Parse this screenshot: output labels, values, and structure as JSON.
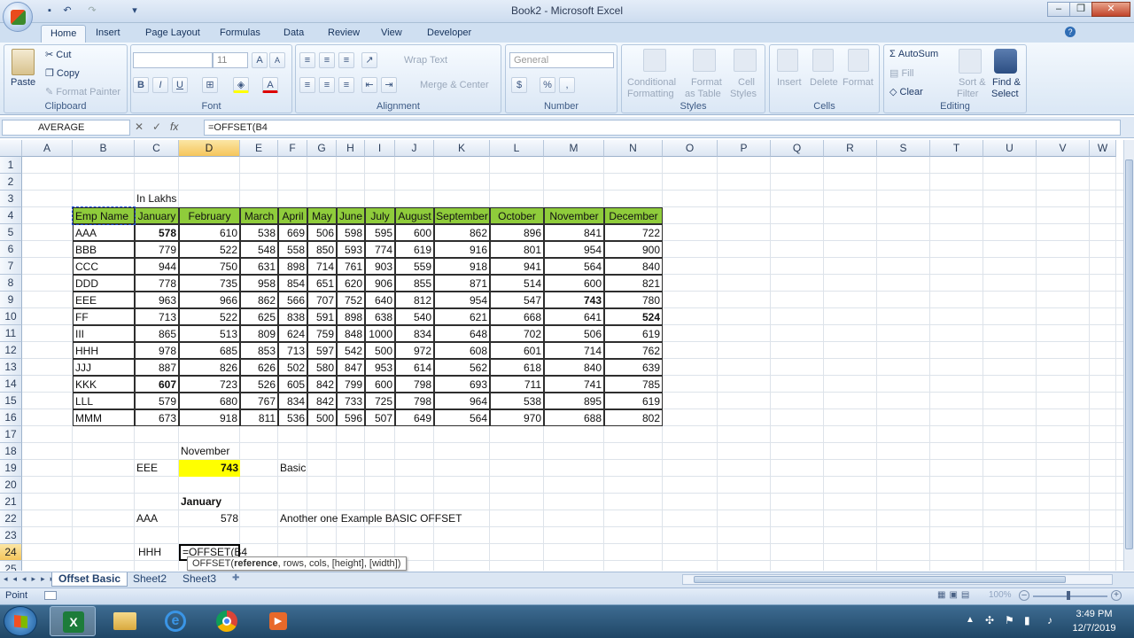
{
  "window": {
    "title": "Book2 - Microsoft Excel"
  },
  "tabs": [
    "Home",
    "Insert",
    "Page Layout",
    "Formulas",
    "Data",
    "Review",
    "View",
    "Developer"
  ],
  "active_tab": "Home",
  "ribbon": {
    "clipboard": {
      "paste": "Paste",
      "cut": "Cut",
      "copy": "Copy",
      "format_painter": "Format Painter",
      "label": "Clipboard"
    },
    "font": {
      "size": "11",
      "label": "Font"
    },
    "alignment": {
      "wrap_text": "Wrap Text",
      "merge_center": "Merge & Center",
      "label": "Alignment"
    },
    "number": {
      "format": "General",
      "label": "Number"
    },
    "styles": {
      "conditional": "Conditional",
      "formatting": "Formatting",
      "format": "Format",
      "as_table": "as Table",
      "cell": "Cell",
      "cell_styles": "Styles",
      "label": "Styles"
    },
    "cells": {
      "insert": "Insert",
      "delete": "Delete",
      "format": "Format",
      "label": "Cells"
    },
    "editing": {
      "autosum": "AutoSum",
      "fill": "Fill",
      "clear": "Clear",
      "sort": "Sort &",
      "filter": "Filter",
      "find": "Find &",
      "select": "Select",
      "label": "Editing"
    }
  },
  "namebox": "AVERAGE",
  "formula": "=OFFSET(B4",
  "columns": [
    "A",
    "B",
    "C",
    "D",
    "E",
    "F",
    "G",
    "H",
    "I",
    "J",
    "K",
    "L",
    "M",
    "N",
    "O",
    "P",
    "Q",
    "R",
    "S",
    "T",
    "U",
    "V",
    "W"
  ],
  "rows": [
    "1",
    "2",
    "3",
    "4",
    "5",
    "6",
    "7",
    "8",
    "9",
    "10",
    "11",
    "12",
    "13",
    "14",
    "15",
    "16",
    "17",
    "18",
    "19",
    "20",
    "21",
    "22",
    "23",
    "24",
    "25"
  ],
  "sheet": {
    "in_lakhs": "In Lakhs",
    "header": [
      "Emp Name",
      "January",
      "February",
      "March",
      "April",
      "May",
      "June",
      "July",
      "August",
      "September",
      "October",
      "November",
      "December"
    ],
    "data": [
      [
        "AAA",
        "578",
        "610",
        "538",
        "669",
        "506",
        "598",
        "595",
        "600",
        "862",
        "896",
        "841",
        "722"
      ],
      [
        "BBB",
        "779",
        "522",
        "548",
        "558",
        "850",
        "593",
        "774",
        "619",
        "916",
        "801",
        "954",
        "900"
      ],
      [
        "CCC",
        "944",
        "750",
        "631",
        "898",
        "714",
        "761",
        "903",
        "559",
        "918",
        "941",
        "564",
        "840"
      ],
      [
        "DDD",
        "778",
        "735",
        "958",
        "854",
        "651",
        "620",
        "906",
        "855",
        "871",
        "514",
        "600",
        "821"
      ],
      [
        "EEE",
        "963",
        "966",
        "862",
        "566",
        "707",
        "752",
        "640",
        "812",
        "954",
        "547",
        "743",
        "780"
      ],
      [
        "FF",
        "713",
        "522",
        "625",
        "838",
        "591",
        "898",
        "638",
        "540",
        "621",
        "668",
        "641",
        "524"
      ],
      [
        "III",
        "865",
        "513",
        "809",
        "624",
        "759",
        "848",
        "1000",
        "834",
        "648",
        "702",
        "506",
        "619"
      ],
      [
        "HHH",
        "978",
        "685",
        "853",
        "713",
        "597",
        "542",
        "500",
        "972",
        "608",
        "601",
        "714",
        "762"
      ],
      [
        "JJJ",
        "887",
        "826",
        "626",
        "502",
        "580",
        "847",
        "953",
        "614",
        "562",
        "618",
        "840",
        "639"
      ],
      [
        "KKK",
        "607",
        "723",
        "526",
        "605",
        "842",
        "799",
        "600",
        "798",
        "693",
        "711",
        "741",
        "785"
      ],
      [
        "LLL",
        "579",
        "680",
        "767",
        "834",
        "842",
        "733",
        "725",
        "798",
        "964",
        "538",
        "895",
        "619"
      ],
      [
        "MMM",
        "673",
        "918",
        "811",
        "536",
        "500",
        "596",
        "507",
        "649",
        "564",
        "970",
        "688",
        "802"
      ]
    ],
    "november_label": "November",
    "eee_label": "EEE",
    "eee_value": "743",
    "basic_label": "Basic",
    "january_label": "January",
    "aaa_label": "AAA",
    "aaa_value": "578",
    "example_label": "Another one Example BASIC OFFSET",
    "hhh_label": "HHH",
    "editing_cell": "=OFFSET(B4"
  },
  "tooltip": {
    "func": "OFFSET(",
    "arg1": "reference",
    ",rest": ", rows, cols, [height], [width])"
  },
  "sheet_tabs": [
    "Offset Basic",
    "Sheet2",
    "Sheet3"
  ],
  "status": {
    "mode": "Point",
    "zoom": "100%"
  },
  "clock": {
    "time": "3:49 PM",
    "date": "12/7/2019"
  },
  "colors": {
    "header_fill": "#8fcc3b",
    "highlight_fill": "#ffff00",
    "selected_col": "#f5c55c"
  }
}
